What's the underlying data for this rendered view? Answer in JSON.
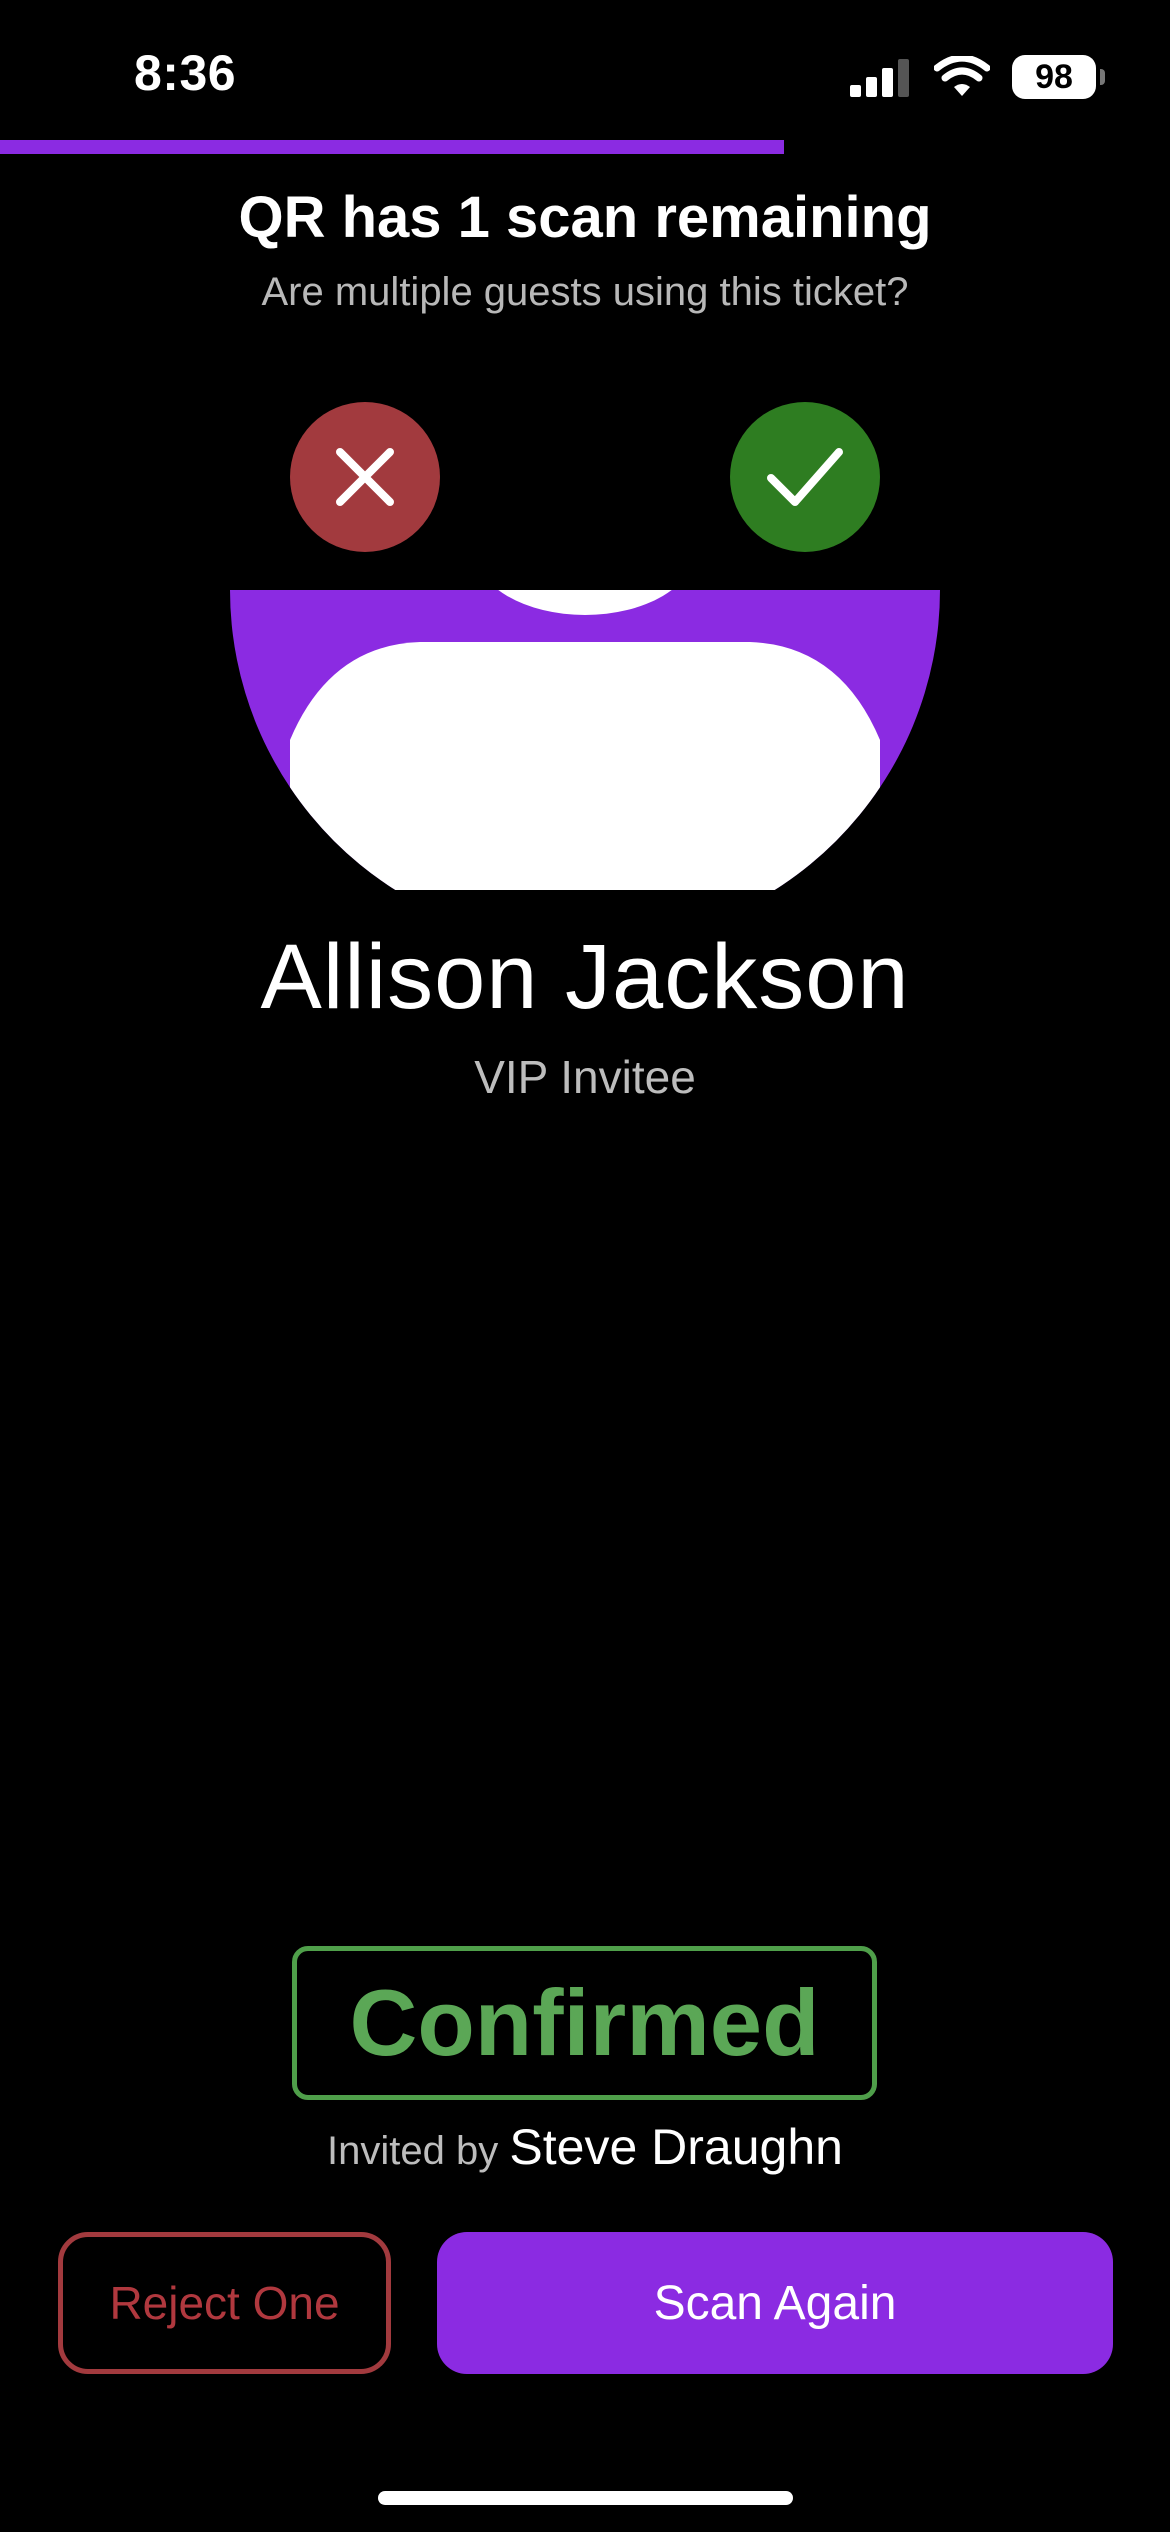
{
  "status_bar": {
    "time": "8:36",
    "battery": "98",
    "icons": [
      "cellular-signal-icon",
      "wifi-icon",
      "battery-icon"
    ]
  },
  "progress": {
    "fraction": 0.67,
    "color": "#8B2BE2"
  },
  "header": {
    "title": "QR has 1 scan remaining",
    "subtitle": "Are multiple guests using this ticket?"
  },
  "actions": {
    "reject_icon": "close-icon",
    "accept_icon": "checkmark-icon",
    "reject_color": "#A23A3E",
    "accept_color": "#2E7D21"
  },
  "avatar": {
    "icon": "person-avatar-icon",
    "color": "#8B2BE2"
  },
  "guest": {
    "name": "Allison Jackson",
    "role": "VIP Invitee"
  },
  "status": {
    "label": "Confirmed",
    "color": "#5BA756"
  },
  "invitation": {
    "prefix": "Invited by",
    "inviter": "Steve Draughn"
  },
  "buttons": {
    "reject_one": "Reject One",
    "scan_again": "Scan Again"
  }
}
